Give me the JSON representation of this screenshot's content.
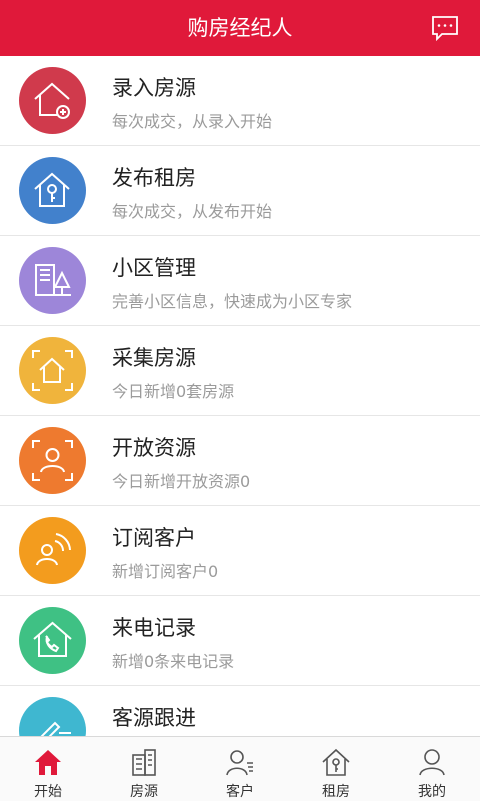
{
  "header": {
    "title": "购房经纪人",
    "icon": "message-icon"
  },
  "colors": {
    "accent": "#e0193a"
  },
  "list": [
    {
      "title": "录入房源",
      "subtitle": "每次成交，从录入开始",
      "icon": "house-add-icon",
      "color": "#d03a4c"
    },
    {
      "title": "发布租房",
      "subtitle": "每次成交，从发布开始",
      "icon": "house-key-icon",
      "color": "#4281cc"
    },
    {
      "title": "小区管理",
      "subtitle": "完善小区信息，快速成为小区专家",
      "icon": "community-icon",
      "color": "#9d86d9"
    },
    {
      "title": "采集房源",
      "subtitle": "今日新增0套房源",
      "icon": "house-scan-icon",
      "color": "#f0b43c"
    },
    {
      "title": "开放资源",
      "subtitle": "今日新增开放资源0",
      "icon": "person-scan-icon",
      "color": "#ee7a2f"
    },
    {
      "title": "订阅客户",
      "subtitle": "新增订阅客户0",
      "icon": "subscribe-icon",
      "color": "#f39c1e"
    },
    {
      "title": "来电记录",
      "subtitle": "新增0条来电记录",
      "icon": "phone-house-icon",
      "color": "#3fc184"
    },
    {
      "title": "客源跟进",
      "subtitle": "",
      "icon": "followup-icon",
      "color": "#3fb7d0"
    }
  ],
  "tabs": [
    {
      "label": "开始",
      "icon": "home-icon",
      "active": true
    },
    {
      "label": "房源",
      "icon": "building-icon",
      "active": false
    },
    {
      "label": "客户",
      "icon": "customer-icon",
      "active": false
    },
    {
      "label": "租房",
      "icon": "rent-house-icon",
      "active": false
    },
    {
      "label": "我的",
      "icon": "profile-icon",
      "active": false
    }
  ]
}
